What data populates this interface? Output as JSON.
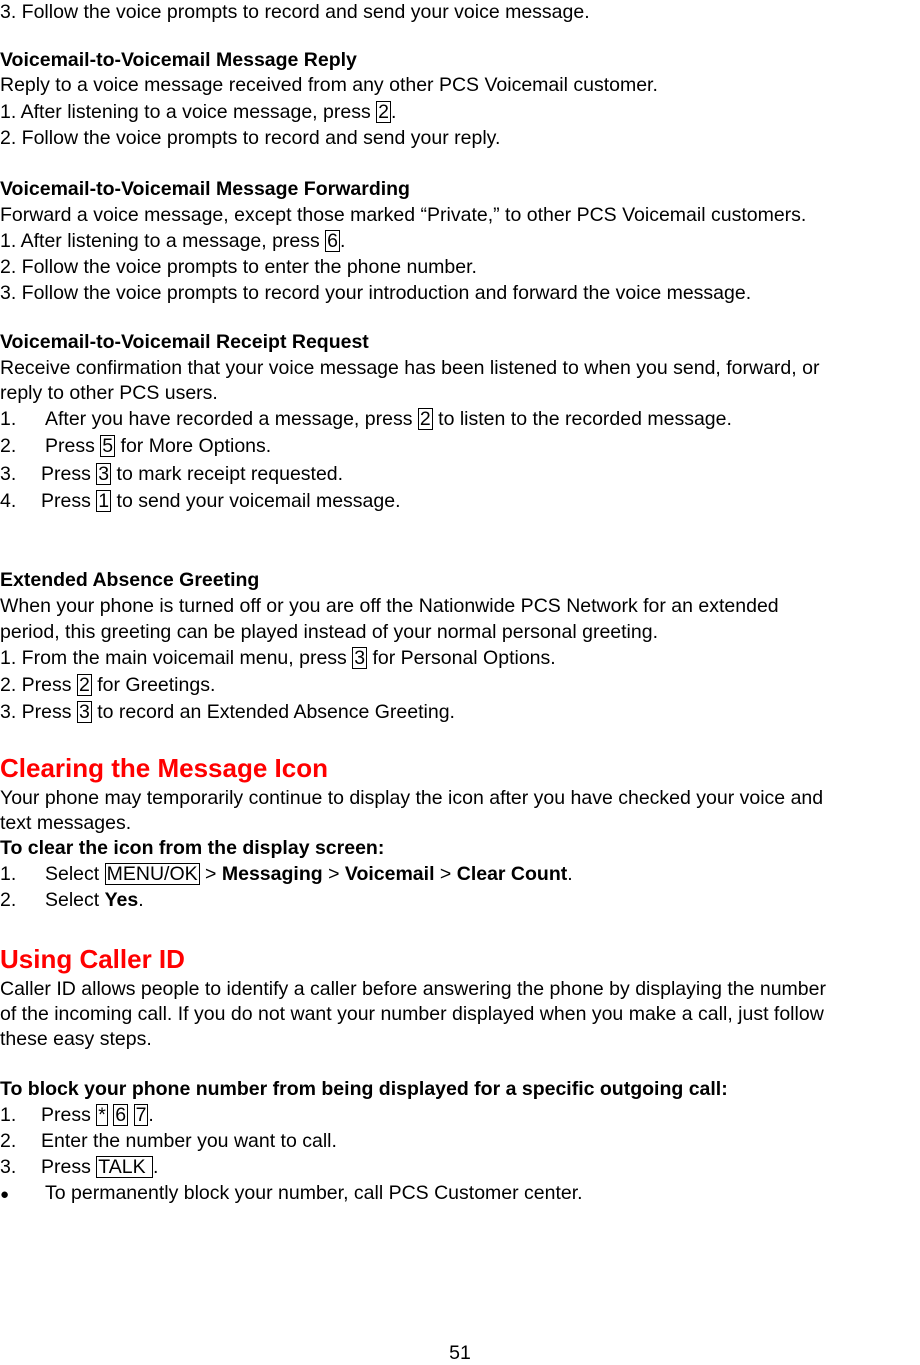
{
  "intro": {
    "step3": "3. Follow the voice prompts to record and send your voice message."
  },
  "reply": {
    "title": "Voicemail-to-Voicemail Message Reply",
    "desc": "Reply to a voice message received from any other PCS Voicemail customer.",
    "step1_pre": "1. After listening to a voice message, press ",
    "step1_key": "2",
    "step1_post": ".",
    "step2": "2. Follow the voice prompts to record and send your reply."
  },
  "forwarding": {
    "title": "Voicemail-to-Voicemail Message Forwarding",
    "desc": "Forward a voice message, except those marked “Private,” to other PCS Voicemail customers.",
    "step1_pre": "1. After listening to a message, press ",
    "step1_key": "6",
    "step1_post": ".",
    "step2": "2. Follow the voice prompts to enter the phone number.",
    "step3": "3. Follow the voice prompts to record your introduction and forward the voice message."
  },
  "receipt": {
    "title": "Voicemail-to-Voicemail Receipt Request",
    "desc_line1": "Receive confirmation that your voice message has been listened to when you send, forward, or",
    "desc_line2": "reply to other PCS users.",
    "steps": [
      {
        "num": "1.",
        "pre": "After you have recorded a message, press ",
        "key": "2",
        "post": " to listen to the recorded message."
      },
      {
        "num": "2.",
        "pre": "Press ",
        "key": "5",
        "post": " for More Options."
      },
      {
        "num": "3.",
        "pre": "Press ",
        "key": "3",
        "post": " to mark receipt requested."
      },
      {
        "num": "4.",
        "pre": "Press ",
        "key": "1",
        "post": " to send your voicemail message."
      }
    ]
  },
  "absence": {
    "title": "Extended Absence Greeting",
    "desc_line1": "When your phone is turned off or you are off the Nationwide PCS Network for an extended",
    "desc_line2": "period, this greeting can be played instead of your normal personal greeting.",
    "steps": [
      {
        "pre": "1. From the main voicemail menu, press ",
        "key": "3",
        "post": " for Personal Options."
      },
      {
        "pre": "2. Press ",
        "key": "2",
        "post": " for Greetings."
      },
      {
        "pre": "3. Press ",
        "key": "3",
        "post": " to record an Extended Absence Greeting."
      }
    ]
  },
  "clearing": {
    "title": "Clearing the Message Icon",
    "desc_line1": "Your phone may temporarily continue to display the icon after you have checked your voice and",
    "desc_line2": "text messages.",
    "subtitle": "To clear the icon from the display screen:",
    "step1": {
      "num": "1.",
      "pre": "Select ",
      "key": "MENU/OK",
      "sep1": " > ",
      "b1": "Messaging",
      "sep2": " > ",
      "b2": "Voicemail",
      "sep3": " > ",
      "b3": "Clear Count",
      "post": "."
    },
    "step2": {
      "num": "2.",
      "pre": "Select ",
      "b1": "Yes",
      "post": "."
    }
  },
  "caller_id": {
    "title": "Using Caller ID",
    "desc_line1": "Caller ID allows people to identify a caller before answering the phone by displaying the number",
    "desc_line2": "of the incoming call. If you do not want your number displayed when you make a call, just follow",
    "desc_line3": "these easy steps.",
    "subtitle": "To block your phone number from being displayed for a specific outgoing call:",
    "step1": {
      "num": "1.",
      "pre": "Press ",
      "keys": [
        "*",
        "6",
        "7"
      ],
      "post": "."
    },
    "step2": {
      "num": "2.",
      "text": "Enter the number you want to call."
    },
    "step3": {
      "num": "3.",
      "pre": "Press ",
      "key": "TALK ",
      "post": "."
    },
    "bullet": {
      "glyph": "●",
      "text": "To permanently block your number, call PCS Customer center."
    }
  },
  "footer": {
    "page_number": "51"
  }
}
